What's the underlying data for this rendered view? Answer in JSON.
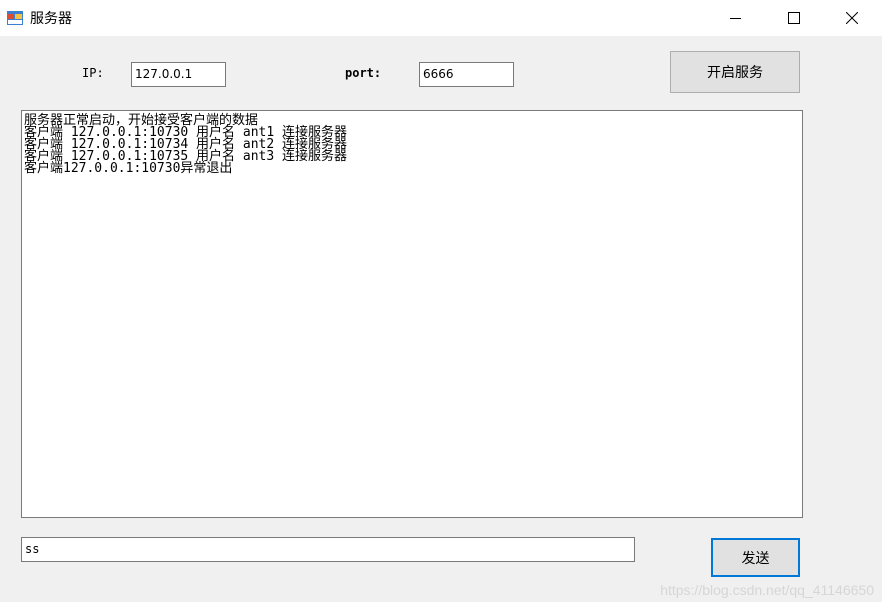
{
  "window": {
    "title": "服务器",
    "icon": "app-window-icon",
    "controls": [
      "minimize-icon",
      "maximize-icon",
      "close-icon"
    ]
  },
  "config": {
    "ip_label": "IP:",
    "ip_value": "127.0.0.1",
    "port_label": "port:",
    "port_value": "6666",
    "start_button": "开启服务"
  },
  "log": {
    "lines": [
      "服务器正常启动，开始接受客户端的数据",
      "客户端 127.0.0.1:10730 用户名 ant1 连接服务器",
      "客户端 127.0.0.1:10734 用户名 ant2 连接服务器",
      "客户端 127.0.0.1:10735 用户名 ant3 连接服务器",
      "客户端127.0.0.1:10730异常退出"
    ]
  },
  "message": {
    "value": "ss",
    "send_button": "发送"
  },
  "watermark": "https://blog.csdn.net/qq_41146650",
  "colors": {
    "focus_border": "#0078d7",
    "window_bg": "#f0f0f0"
  }
}
